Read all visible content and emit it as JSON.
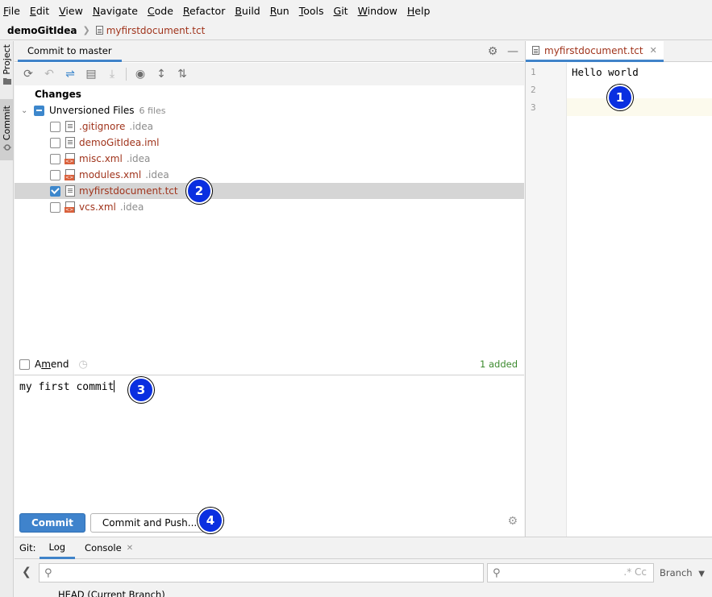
{
  "menu": [
    {
      "mn": "F",
      "rest": "ile"
    },
    {
      "mn": "E",
      "rest": "dit"
    },
    {
      "mn": "V",
      "rest": "iew"
    },
    {
      "mn": "N",
      "rest": "avigate"
    },
    {
      "mn": "C",
      "rest": "ode"
    },
    {
      "mn": "R",
      "rest": "efactor"
    },
    {
      "mn": "B",
      "rest": "uild"
    },
    {
      "mn": "R",
      "rest": "un"
    },
    {
      "mn": "T",
      "rest": "ools"
    },
    {
      "mn": "G",
      "rest": "it"
    },
    {
      "mn": "W",
      "rest": "indow"
    },
    {
      "mn": "H",
      "rest": "elp"
    }
  ],
  "breadcrumb": {
    "project": "demoGitIdea",
    "file": "myfirstdocument.tct"
  },
  "left_strip": {
    "project_label": "Project",
    "commit_label": "Commit"
  },
  "commit_panel": {
    "tab_label": "Commit to master",
    "changes_label": "Changes",
    "unversioned": {
      "label": "Unversioned Files",
      "count": "6 files"
    },
    "files": [
      {
        "name": ".gitignore",
        "dir": ".idea",
        "checked": false,
        "icon": "gitignore-file-icon"
      },
      {
        "name": "demoGitIdea.iml",
        "dir": "",
        "checked": false,
        "icon": "iml-file-icon"
      },
      {
        "name": "misc.xml",
        "dir": ".idea",
        "checked": false,
        "icon": "xml-file-icon"
      },
      {
        "name": "modules.xml",
        "dir": ".idea",
        "checked": false,
        "icon": "xml-file-icon"
      },
      {
        "name": "myfirstdocument.tct",
        "dir": "",
        "checked": true,
        "icon": "text-file-icon"
      },
      {
        "name": "vcs.xml",
        "dir": ".idea",
        "checked": false,
        "icon": "xml-file-icon"
      }
    ],
    "amend_label": "Amend",
    "amend_mnemonic": "m",
    "added_count": "1 added",
    "commit_message": "my first commit",
    "commit_button": "Commit",
    "commit_push_button": "Commit and Push..."
  },
  "editor": {
    "tab_label": "myfirstdocument.tct",
    "line_numbers": [
      "1",
      "2",
      "3"
    ],
    "lines": [
      "Hello world",
      "",
      ""
    ]
  },
  "bottom": {
    "git_label": "Git:",
    "tabs": [
      "Log",
      "Console"
    ],
    "head_label": "HEAD (Current Branch)",
    "branch_label": "Branch",
    "filter_glyphs": ".*  Cc"
  },
  "badges": [
    "1",
    "2",
    "3",
    "4"
  ],
  "colors": {
    "accent": "#4083c9",
    "file_new": "#a0341c",
    "added": "#3c8a2e",
    "badge": "#0a2fe0"
  }
}
